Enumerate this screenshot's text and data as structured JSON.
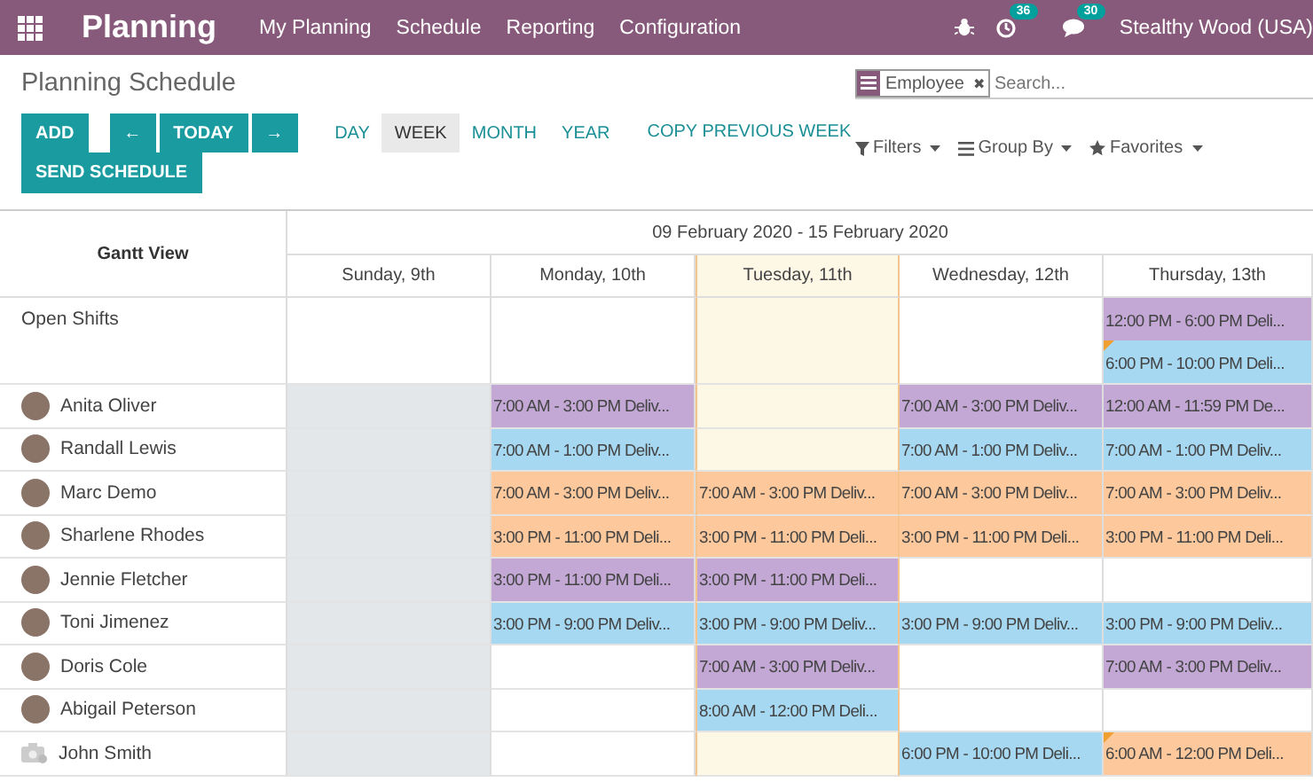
{
  "navbar": {
    "app": "Planning",
    "menu": [
      "My Planning",
      "Schedule",
      "Reporting",
      "Configuration"
    ],
    "activity_count": "36",
    "message_count": "30",
    "user": "Stealthy Wood (USA)"
  },
  "breadcrumb": "Planning Schedule",
  "search": {
    "facet": "Employee",
    "remove": "✖",
    "placeholder": "Search..."
  },
  "buttons": {
    "add": "ADD",
    "prev": "←",
    "today": "TODAY",
    "next": "→",
    "send": "SEND SCHEDULE"
  },
  "scales": [
    {
      "label": "DAY",
      "selected": false
    },
    {
      "label": "WEEK",
      "selected": true
    },
    {
      "label": "MONTH",
      "selected": false
    },
    {
      "label": "YEAR",
      "selected": false
    }
  ],
  "copy_link": "COPY PREVIOUS WEEK",
  "search_options": [
    "Filters",
    "Group By",
    "Favorites"
  ],
  "gantt": {
    "title": "Gantt View",
    "range": "09 February 2020 - 15 February 2020",
    "days": [
      {
        "label": "Sunday, 9th",
        "today": false
      },
      {
        "label": "Monday, 10th",
        "today": false
      },
      {
        "label": "Tuesday, 11th",
        "today": true
      },
      {
        "label": "Wednesday, 12th",
        "today": false
      },
      {
        "label": "Thursday, 13th",
        "today": false
      }
    ],
    "rows": [
      {
        "name": "Open Shifts",
        "kind": "open",
        "cells": [
          {
            "off": false
          },
          {
            "off": false
          },
          {
            "off": false
          },
          {
            "off": false
          },
          {
            "off": false,
            "shifts": [
              {
                "text": "12:00 PM - 6:00 PM Deli...",
                "color": "#c3a8d6",
                "warning": false
              },
              {
                "text": "6:00 PM - 10:00 PM Deli...",
                "color": "#a6d8f2",
                "warning": true
              }
            ]
          }
        ]
      },
      {
        "name": "Anita Oliver",
        "kind": "photo",
        "cells": [
          {
            "off": true
          },
          {
            "off": false,
            "shifts": [
              {
                "text": "7:00 AM - 3:00 PM Deliv...",
                "color": "#c3a8d6",
                "warning": false
              }
            ]
          },
          {
            "off": false
          },
          {
            "off": false,
            "shifts": [
              {
                "text": "7:00 AM - 3:00 PM Deliv...",
                "color": "#c3a8d6",
                "warning": false
              }
            ]
          },
          {
            "off": false,
            "shifts": [
              {
                "text": "12:00 AM - 11:59 PM De...",
                "color": "#c3a8d6",
                "warning": false
              }
            ]
          }
        ]
      },
      {
        "name": "Randall Lewis",
        "kind": "photo",
        "cells": [
          {
            "off": true
          },
          {
            "off": false,
            "shifts": [
              {
                "text": "7:00 AM - 1:00 PM Deliv...",
                "color": "#a6d8f2",
                "warning": false
              }
            ]
          },
          {
            "off": false
          },
          {
            "off": false,
            "shifts": [
              {
                "text": "7:00 AM - 1:00 PM Deliv...",
                "color": "#a6d8f2",
                "warning": false
              }
            ]
          },
          {
            "off": false,
            "shifts": [
              {
                "text": "7:00 AM - 1:00 PM Deliv...",
                "color": "#a6d8f2",
                "warning": false
              }
            ]
          }
        ]
      },
      {
        "name": "Marc Demo",
        "kind": "photo",
        "cells": [
          {
            "off": true
          },
          {
            "off": false,
            "shifts": [
              {
                "text": "7:00 AM - 3:00 PM Deliv...",
                "color": "#fcc89c",
                "warning": false
              }
            ]
          },
          {
            "off": false,
            "shifts": [
              {
                "text": "7:00 AM - 3:00 PM Deliv...",
                "color": "#fcc89c",
                "warning": false
              }
            ]
          },
          {
            "off": false,
            "shifts": [
              {
                "text": "7:00 AM - 3:00 PM Deliv...",
                "color": "#fcc89c",
                "warning": false
              }
            ]
          },
          {
            "off": false,
            "shifts": [
              {
                "text": "7:00 AM - 3:00 PM Deliv...",
                "color": "#fcc89c",
                "warning": false
              }
            ]
          }
        ]
      },
      {
        "name": "Sharlene Rhodes",
        "kind": "photo",
        "cells": [
          {
            "off": true
          },
          {
            "off": false,
            "shifts": [
              {
                "text": "3:00 PM - 11:00 PM Deli...",
                "color": "#fcc89c",
                "warning": false
              }
            ]
          },
          {
            "off": false,
            "shifts": [
              {
                "text": "3:00 PM - 11:00 PM Deli...",
                "color": "#fcc89c",
                "warning": false
              }
            ]
          },
          {
            "off": false,
            "shifts": [
              {
                "text": "3:00 PM - 11:00 PM Deli...",
                "color": "#fcc89c",
                "warning": false
              }
            ]
          },
          {
            "off": false,
            "shifts": [
              {
                "text": "3:00 PM - 11:00 PM Deli...",
                "color": "#fcc89c",
                "warning": false
              }
            ]
          }
        ]
      },
      {
        "name": "Jennie Fletcher",
        "kind": "photo",
        "cells": [
          {
            "off": true
          },
          {
            "off": false,
            "shifts": [
              {
                "text": "3:00 PM - 11:00 PM Deli...",
                "color": "#c3a8d6",
                "warning": false
              }
            ]
          },
          {
            "off": false,
            "shifts": [
              {
                "text": "3:00 PM - 11:00 PM Deli...",
                "color": "#c3a8d6",
                "warning": false
              }
            ]
          },
          {
            "off": false
          },
          {
            "off": false
          }
        ]
      },
      {
        "name": "Toni Jimenez",
        "kind": "photo",
        "cells": [
          {
            "off": true
          },
          {
            "off": false,
            "shifts": [
              {
                "text": "3:00 PM - 9:00 PM Deliv...",
                "color": "#a6d8f2",
                "warning": false
              }
            ]
          },
          {
            "off": false,
            "shifts": [
              {
                "text": "3:00 PM - 9:00 PM Deliv...",
                "color": "#a6d8f2",
                "warning": false
              }
            ]
          },
          {
            "off": false,
            "shifts": [
              {
                "text": "3:00 PM - 9:00 PM Deliv...",
                "color": "#a6d8f2",
                "warning": false
              }
            ]
          },
          {
            "off": false,
            "shifts": [
              {
                "text": "3:00 PM - 9:00 PM Deliv...",
                "color": "#a6d8f2",
                "warning": false
              }
            ]
          }
        ]
      },
      {
        "name": "Doris Cole",
        "kind": "photo",
        "cells": [
          {
            "off": true
          },
          {
            "off": false
          },
          {
            "off": false,
            "shifts": [
              {
                "text": "7:00 AM - 3:00 PM Deliv...",
                "color": "#c3a8d6",
                "warning": false
              }
            ]
          },
          {
            "off": false
          },
          {
            "off": false,
            "shifts": [
              {
                "text": "7:00 AM - 3:00 PM Deliv...",
                "color": "#c3a8d6",
                "warning": false
              }
            ]
          }
        ]
      },
      {
        "name": "Abigail Peterson",
        "kind": "photo",
        "cells": [
          {
            "off": true
          },
          {
            "off": false
          },
          {
            "off": false,
            "shifts": [
              {
                "text": "8:00 AM - 12:00 PM Deli...",
                "color": "#a6d8f2",
                "warning": false
              }
            ]
          },
          {
            "off": false
          },
          {
            "off": false
          }
        ]
      },
      {
        "name": "John Smith",
        "kind": "placeholder",
        "cells": [
          {
            "off": true
          },
          {
            "off": false
          },
          {
            "off": false
          },
          {
            "off": false,
            "shifts": [
              {
                "text": "6:00 PM - 10:00 PM Deli...",
                "color": "#a6d8f2",
                "warning": false
              }
            ]
          },
          {
            "off": false,
            "shifts": [
              {
                "text": "6:00 AM - 12:00 PM Deli...",
                "color": "#fcc89c",
                "warning": true
              }
            ]
          }
        ]
      }
    ]
  }
}
